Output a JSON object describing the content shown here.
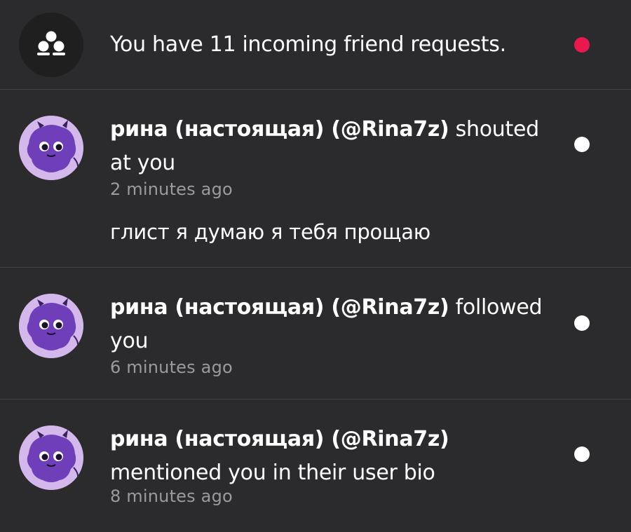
{
  "friend_requests": {
    "icon": "friends-group-icon",
    "text": "You have 11 incoming friend requests.",
    "unread_dot_color": "#e8194e"
  },
  "notifications": [
    {
      "username": "рина (настоящая) (@Rina7z)",
      "action": "shouted at you",
      "time": "2 minutes ago",
      "message": "глист я думаю я тебя прощаю",
      "avatar": "purple-monster-avatar"
    },
    {
      "username": "рина (настоящая) (@Rina7z)",
      "action": "followed you",
      "time": "6 minutes ago",
      "avatar": "purple-monster-avatar"
    },
    {
      "username": "рина (настоящая) (@Rina7z)",
      "action": "mentioned you in their user bio",
      "time": "8 minutes ago",
      "avatar": "purple-monster-avatar"
    }
  ],
  "colors": {
    "background": "#2b2b2d",
    "divider": "#444446",
    "secondary_text": "#9b9b9e",
    "unread_dot_notification": "#ffffff"
  }
}
